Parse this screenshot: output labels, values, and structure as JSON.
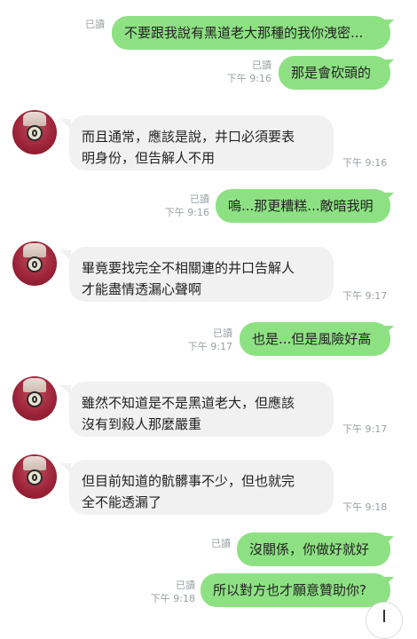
{
  "conversation": {
    "messages": [
      {
        "side": "out",
        "read": "已讀",
        "time": "",
        "lines": [
          "不要跟我說有黑道老大那種的我你洩密..."
        ]
      },
      {
        "side": "out",
        "read": "已讀",
        "time": "下午 9:16",
        "lines": [
          "那是會砍頭的"
        ]
      },
      {
        "side": "in",
        "time": "下午 9:16",
        "lines": [
          "而且通常，應該是說，井口必須要表",
          "明身份，但告解人不用"
        ]
      },
      {
        "side": "out",
        "read": "已讀",
        "time": "下午 9:16",
        "lines": [
          "嗚...那更糟糕...敵暗我明"
        ]
      },
      {
        "side": "in",
        "time": "下午 9:17",
        "lines": [
          "畢竟要找完全不相關連的井口告解人",
          "才能盡情透漏心聲啊"
        ]
      },
      {
        "side": "out",
        "read": "已讀",
        "time": "下午 9:17",
        "lines": [
          "也是...但是風險好高"
        ]
      },
      {
        "side": "in",
        "time": "下午 9:17",
        "lines": [
          "雖然不知道是不是黑道老大，但應該",
          "沒有到殺人那麼嚴重"
        ]
      },
      {
        "side": "in",
        "time": "下午 9:18",
        "lines": [
          "但目前知道的骯髒事不少，但也就完",
          "全不能透漏了"
        ]
      },
      {
        "side": "out",
        "read": "已讀",
        "time": "",
        "lines": [
          "沒關係，你做好就好"
        ]
      },
      {
        "side": "out",
        "read": "已讀",
        "time": "下午 9:18",
        "lines": [
          "所以對方也才願意贊助你?"
        ]
      }
    ]
  }
}
